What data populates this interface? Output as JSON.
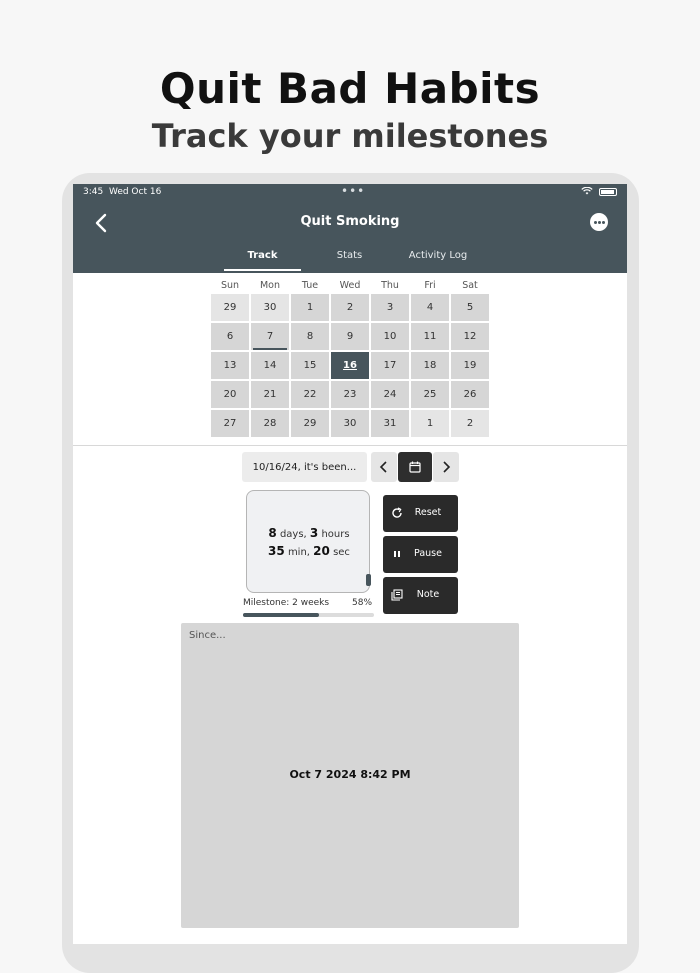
{
  "promo": {
    "headline": "Quit Bad Habits",
    "subheadline": "Track your milestones"
  },
  "status_bar": {
    "time": "3:45",
    "date": "Wed Oct 16"
  },
  "nav": {
    "title": "Quit Smoking",
    "back_icon": "chevron-left-icon",
    "more_icon": "ellipsis-circle-icon"
  },
  "tabs": [
    {
      "label": "Track",
      "active": true
    },
    {
      "label": "Stats",
      "active": false
    },
    {
      "label": "Activity Log",
      "active": false
    }
  ],
  "calendar": {
    "weekdays": [
      "Sun",
      "Mon",
      "Tue",
      "Wed",
      "Thu",
      "Fri",
      "Sat"
    ],
    "weeks": [
      [
        "29",
        "30",
        "1",
        "2",
        "3",
        "4",
        "5"
      ],
      [
        "6",
        "7",
        "8",
        "9",
        "10",
        "11",
        "12"
      ],
      [
        "13",
        "14",
        "15",
        "16",
        "17",
        "18",
        "19"
      ],
      [
        "20",
        "21",
        "22",
        "23",
        "24",
        "25",
        "26"
      ],
      [
        "27",
        "28",
        "29",
        "30",
        "31",
        "1",
        "2"
      ]
    ],
    "today": "16",
    "marked_day": "7"
  },
  "date_picker": {
    "label": "10/16/24, it's been...",
    "calendar_icon": "calendar-icon"
  },
  "timer": {
    "days": "8",
    "days_unit": "days,",
    "hours": "3",
    "hours_unit": "hours",
    "minutes": "35",
    "minutes_unit": "min,",
    "seconds": "20",
    "seconds_unit": "sec"
  },
  "milestone": {
    "label": "Milestone: 2 weeks",
    "percent_text": "58%",
    "progress": 0.58
  },
  "actions": [
    {
      "label": "Reset",
      "icon": "reset-icon"
    },
    {
      "label": "Pause",
      "icon": "pause-icon"
    },
    {
      "label": "Note",
      "icon": "note-icon"
    }
  ],
  "since": {
    "label": "Since...",
    "value": "Oct 7 2024 8:42 PM"
  },
  "colors": {
    "accent": "#47555c",
    "button_dark": "#2a2a2a",
    "day_cell": "#d6d6d6"
  }
}
